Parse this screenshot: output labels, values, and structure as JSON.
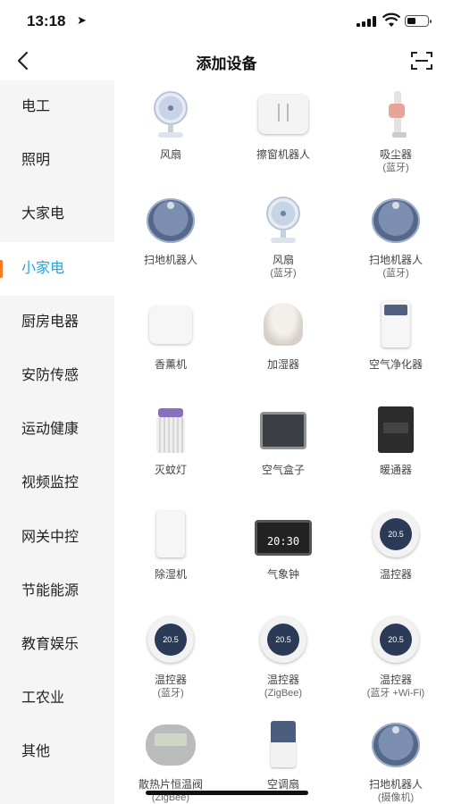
{
  "status_bar": {
    "time": "13:18",
    "location_icon": "location-arrow-icon"
  },
  "nav": {
    "title": "添加设备",
    "back_icon": "back-chevron-icon",
    "scan_icon": "scan-icon"
  },
  "sidebar": {
    "active_color": "#1fa6e6",
    "indicator_color": "#ff7a1a",
    "items": [
      {
        "label": "电工"
      },
      {
        "label": "照明"
      },
      {
        "label": "大家电"
      },
      {
        "label": "小家电",
        "active": true
      },
      {
        "label": "厨房电器"
      },
      {
        "label": "安防传感"
      },
      {
        "label": "运动健康"
      },
      {
        "label": "视频监控"
      },
      {
        "label": "网关中控"
      },
      {
        "label": "节能能源"
      },
      {
        "label": "教育娱乐"
      },
      {
        "label": "工农业"
      },
      {
        "label": "其他"
      }
    ]
  },
  "devices": [
    {
      "label": "风扇",
      "sub": "",
      "icon": "fan-icon"
    },
    {
      "label": "擦窗机器人",
      "sub": "",
      "icon": "window-robot-icon"
    },
    {
      "label": "吸尘器",
      "sub": "(蓝牙)",
      "icon": "vacuum-icon"
    },
    {
      "label": "扫地机器人",
      "sub": "",
      "icon": "robot-vacuum-icon"
    },
    {
      "label": "风扇",
      "sub": "(蓝牙)",
      "icon": "fan-icon"
    },
    {
      "label": "扫地机器人",
      "sub": "(蓝牙)",
      "icon": "robot-vacuum-icon"
    },
    {
      "label": "香薰机",
      "sub": "",
      "icon": "aroma-diffuser-icon"
    },
    {
      "label": "加湿器",
      "sub": "",
      "icon": "humidifier-icon"
    },
    {
      "label": "空气净化器",
      "sub": "",
      "icon": "air-purifier-icon"
    },
    {
      "label": "灭蚊灯",
      "sub": "",
      "icon": "mosquito-lamp-icon"
    },
    {
      "label": "空气盒子",
      "sub": "",
      "icon": "air-box-icon"
    },
    {
      "label": "暖通器",
      "sub": "",
      "icon": "hvac-icon"
    },
    {
      "label": "除湿机",
      "sub": "",
      "icon": "dehumidifier-icon"
    },
    {
      "label": "气象钟",
      "sub": "",
      "icon": "weather-clock-icon",
      "display": "20:30"
    },
    {
      "label": "温控器",
      "sub": "",
      "icon": "thermostat-icon",
      "display": "20.5"
    },
    {
      "label": "温控器",
      "sub": "(蓝牙)",
      "icon": "thermostat-icon",
      "display": "20.5"
    },
    {
      "label": "温控器",
      "sub": "(ZigBee)",
      "icon": "thermostat-icon",
      "display": "20.5"
    },
    {
      "label": "温控器",
      "sub": "(蓝牙 +Wi-Fi)",
      "icon": "thermostat-icon",
      "display": "20.5"
    },
    {
      "label": "散热片恒温阀",
      "sub": "(ZigBee)",
      "icon": "radiator-valve-icon"
    },
    {
      "label": "空调扇",
      "sub": "",
      "icon": "air-cooler-icon"
    },
    {
      "label": "扫地机器人",
      "sub": "(摄像机)",
      "icon": "robot-vacuum-icon"
    }
  ]
}
